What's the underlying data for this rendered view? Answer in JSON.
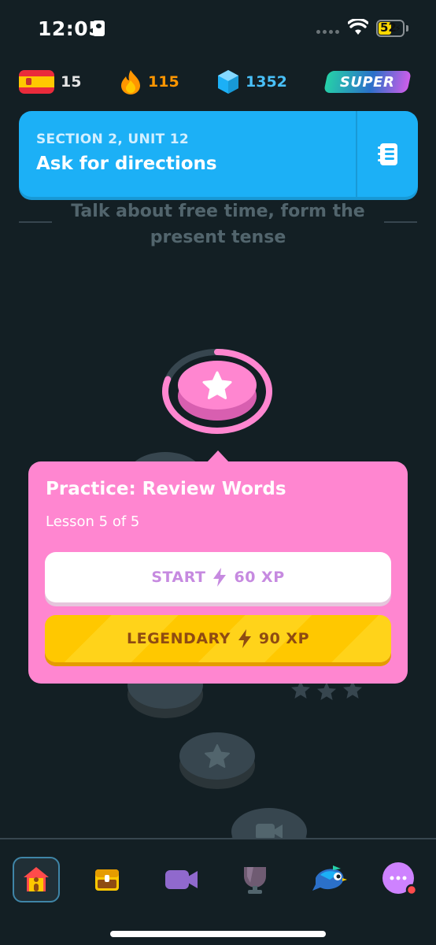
{
  "status_bar": {
    "time": "12:05",
    "battery": "52",
    "battery_level": 0.52
  },
  "stats": {
    "language_flag": "spain-flag-icon",
    "language_count": "15",
    "streak": "115",
    "gems": "1352",
    "super_label": "SUPER"
  },
  "unit": {
    "section": "SECTION 2, UNIT 12",
    "title": "Ask for directions",
    "guide_icon": "guidebook-icon"
  },
  "behind_text": "Talk about free time, form the present tense",
  "lesson": {
    "progress": 0.8
  },
  "popover": {
    "title": "Practice: Review Words",
    "subtitle": "Lesson 5 of 5",
    "start_label": "START",
    "start_xp": "60 XP",
    "legendary_label": "LEGENDARY",
    "legendary_xp": "90 XP"
  },
  "nav": {
    "items": [
      "home-icon",
      "chest-icon",
      "video-call-icon",
      "leaderboard-icon",
      "practice-bird-icon",
      "more-icon"
    ],
    "active": "home-icon"
  },
  "colors": {
    "blue": "#1cb0f6",
    "pink": "#ff86d0",
    "gold": "#ffc800",
    "background": "#131f24"
  }
}
